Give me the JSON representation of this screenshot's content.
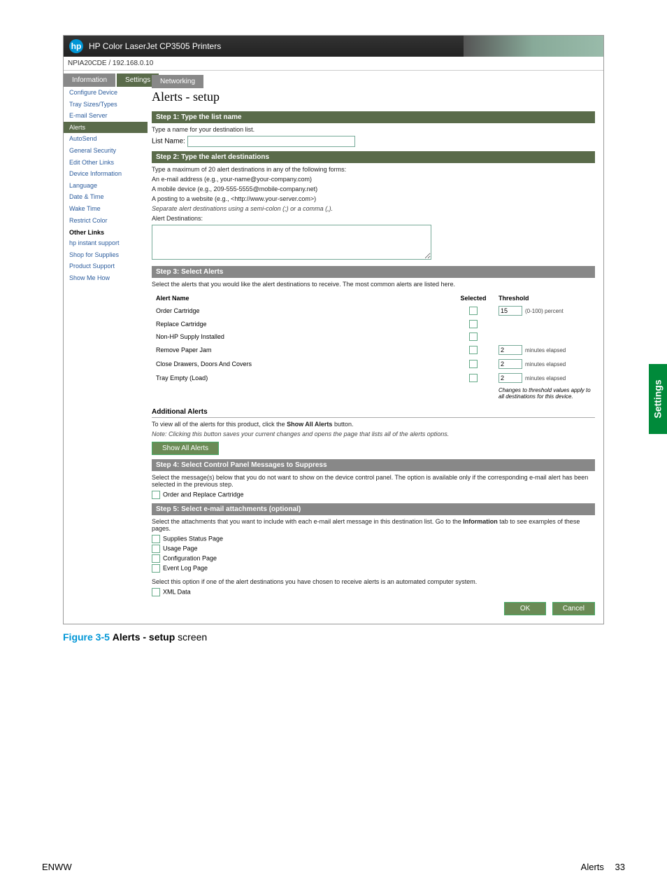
{
  "header": {
    "product_line": "HP Color LaserJet CP3505 Printers",
    "host": "NPIA20CDE / 192.168.0.10"
  },
  "tabs": {
    "information": "Information",
    "settings": "Settings",
    "networking": "Networking"
  },
  "sidebar": {
    "items": [
      "Configure Device",
      "Tray Sizes/Types",
      "E-mail Server",
      "Alerts",
      "AutoSend",
      "General Security",
      "Edit Other Links",
      "Device Information",
      "Language",
      "Date & Time",
      "Wake Time",
      "Restrict Color"
    ],
    "other_links_title": "Other Links",
    "other_links": [
      "hp instant support",
      "Shop for Supplies",
      "Product Support",
      "Show Me How"
    ]
  },
  "page": {
    "title": "Alerts - setup"
  },
  "step1": {
    "bar": "Step 1: Type the list name",
    "prompt": "Type a name for your destination list.",
    "label": "List Name:",
    "value": ""
  },
  "step2": {
    "bar": "Step 2: Type the alert destinations",
    "prompt": "Type a maximum of 20 alert destinations in any of the following forms:",
    "ex1": "An e-mail address (e.g., your-name@your-company.com)",
    "ex2": "A mobile device (e.g., 209-555-5555@mobile-company.net)",
    "ex3": "A posting to a website (e.g., <http://www.your-server.com>)",
    "sep": "Separate alert destinations using a semi-colon (;) or a comma (,).",
    "dest_label": "Alert Destinations:",
    "dest_value": ""
  },
  "step3": {
    "bar": "Step 3: Select Alerts",
    "intro": "Select the alerts that you would like the alert destinations to receive. The most common alerts are listed here.",
    "col_name": "Alert Name",
    "col_sel": "Selected",
    "col_th": "Threshold",
    "rows": [
      {
        "name": "Order Cartridge",
        "th": "15",
        "unit": "(0-100) percent"
      },
      {
        "name": "Replace Cartridge",
        "th": "",
        "unit": ""
      },
      {
        "name": "Non-HP Supply Installed",
        "th": "",
        "unit": ""
      },
      {
        "name": "Remove Paper Jam",
        "th": "2",
        "unit": "minutes elapsed"
      },
      {
        "name": "Close Drawers, Doors And Covers",
        "th": "2",
        "unit": "minutes elapsed"
      },
      {
        "name": "Tray Empty (Load)",
        "th": "2",
        "unit": "minutes elapsed"
      }
    ],
    "th_note": "Changes to threshold values apply to all destinations for this device.",
    "additional_hdr": "Additional Alerts",
    "additional_txt": "To view all of the alerts for this product, click the Show All Alerts button.",
    "additional_note": "Note: Clicking this button saves your current changes and opens the page that lists all of the alerts options.",
    "show_all_btn": "Show All Alerts"
  },
  "step4": {
    "bar": "Step 4: Select Control Panel Messages to Suppress",
    "intro": "Select the message(s) below that you do not want to show on the device control panel. The option is available only if the corresponding e-mail alert has been selected in the previous step.",
    "item": "Order and Replace Cartridge"
  },
  "step5": {
    "bar": "Step 5: Select e-mail attachments (optional)",
    "intro": "Select the attachments that you want to include with each e-mail alert message in this destination list. Go to the Information tab to see examples of these pages.",
    "items": [
      "Supplies Status Page",
      "Usage Page",
      "Configuration Page",
      "Event Log Page"
    ],
    "auto_txt": "Select this option if one of the alert destinations you have chosen to receive alerts is an automated computer system.",
    "xml": "XML Data"
  },
  "buttons": {
    "ok": "OK",
    "cancel": "Cancel"
  },
  "figure": {
    "num": "Figure 3-5",
    "title": "Alerts - setup",
    "suffix": "screen"
  },
  "side_tab": "Settings",
  "footer": {
    "left": "ENWW",
    "right_label": "Alerts",
    "page_no": "33"
  }
}
